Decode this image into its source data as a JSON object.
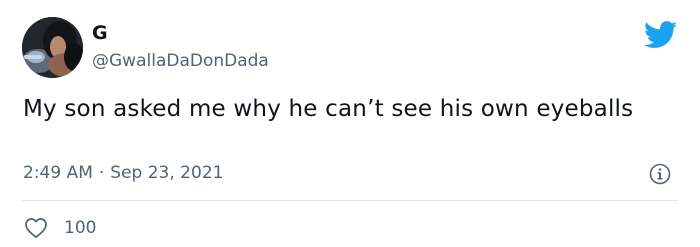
{
  "user": {
    "display_name": "G",
    "handle": "@GwallaDaDonDada",
    "avatar_icon": "user-avatar-photo"
  },
  "tweet": {
    "text": "My son asked me why he can’t see his own eyeballs",
    "time": "2:49 AM",
    "separator": "·",
    "date": "Sep 23, 2021"
  },
  "actions": {
    "like_count": "100",
    "like_icon": "heart-outline-icon",
    "info_icon": "info-icon"
  },
  "brand": {
    "logo_icon": "twitter-bird-icon",
    "accent_color": "#1da1f2",
    "secondary_text_color": "#536471"
  }
}
